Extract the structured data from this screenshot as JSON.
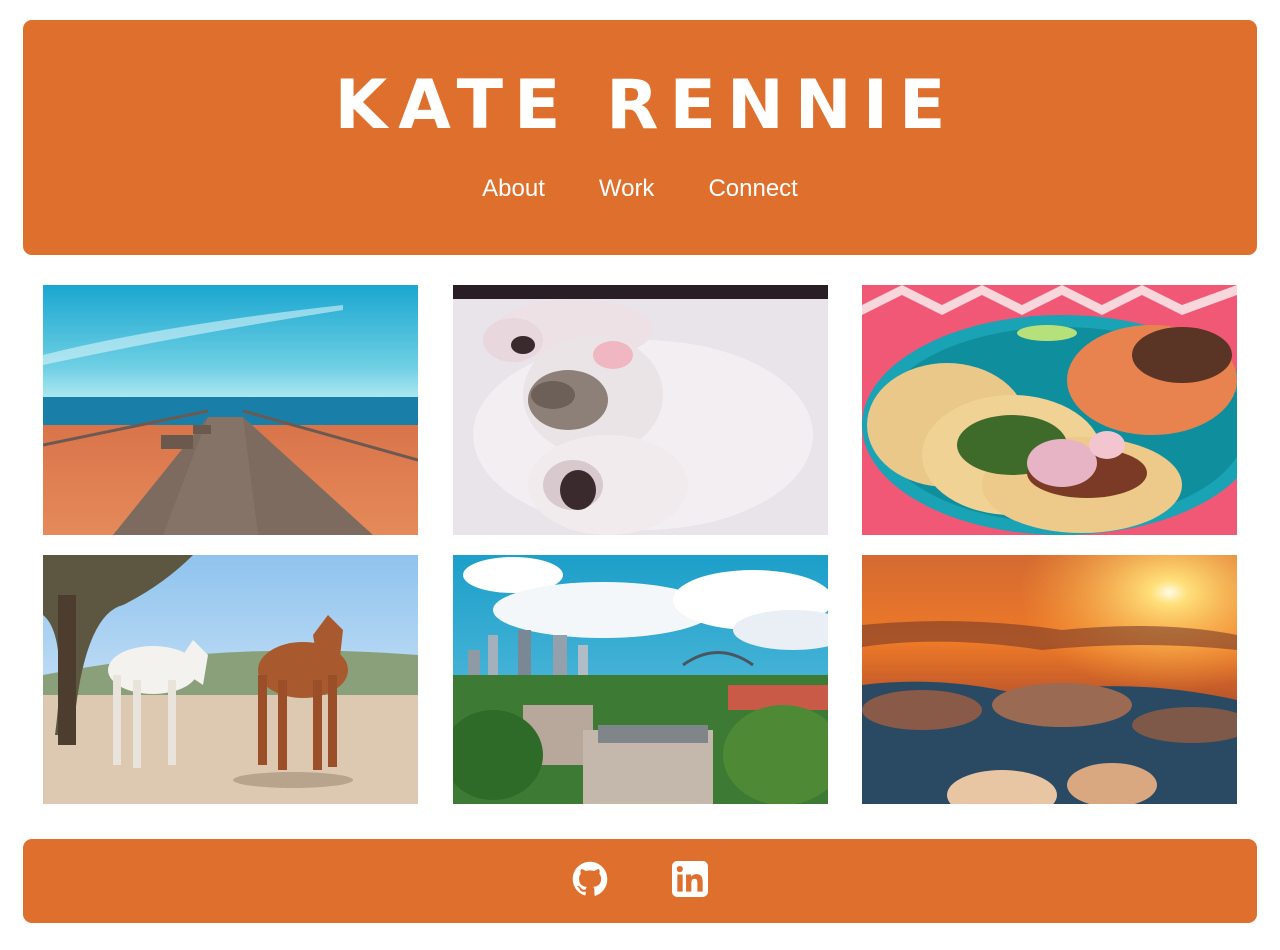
{
  "header": {
    "title": "KATE RENNIE",
    "nav": [
      "About",
      "Work",
      "Connect"
    ]
  },
  "gallery": [
    {
      "subject": "boardwalk-by-the-sea"
    },
    {
      "subject": "sleeping-kitten"
    },
    {
      "subject": "tacos-plate"
    },
    {
      "subject": "two-horses"
    },
    {
      "subject": "city-skyline-with-bridge"
    },
    {
      "subject": "sunset-above-clouds"
    }
  ],
  "footer": {
    "icons": [
      "github-icon",
      "linkedin-icon"
    ]
  },
  "colors": {
    "accent": "#df6f2c",
    "text_on_accent": "#ffffff",
    "background": "#ffffff"
  }
}
